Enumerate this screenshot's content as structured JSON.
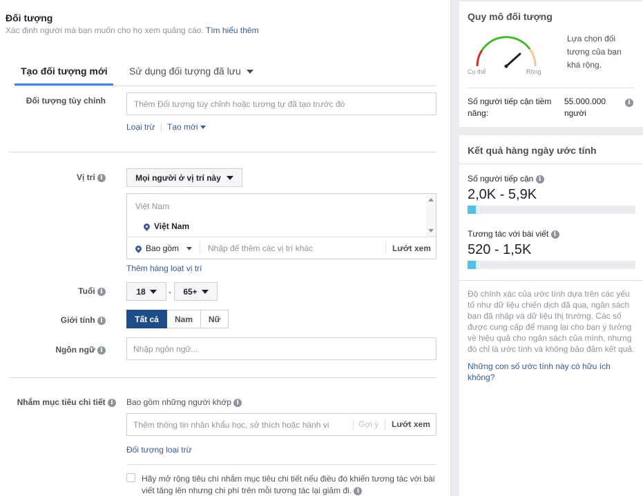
{
  "header": {
    "title": "Đối tượng",
    "subtitle": "Xác định người mà bạn muốn cho họ xem quảng cáo.",
    "learn_more": "Tìm hiểu thêm"
  },
  "tabs": [
    {
      "label": "Tạo đối tượng mới",
      "active": true
    },
    {
      "label": "Sử dụng đối tượng đã lưu",
      "active": false
    }
  ],
  "custom_audience": {
    "label": "Đối tượng tùy chỉnh",
    "placeholder": "Thêm Đối tượng tùy chỉnh hoặc tương tự đã tạo trước đó",
    "exclude": "Loại trừ",
    "create_new": "Tạo mới"
  },
  "location": {
    "label": "Vị trí",
    "dropdown": "Mọi người ở vị trí này",
    "list_header": "Việt Nam",
    "selected": "Việt Nam",
    "include": "Bao gồm",
    "placeholder": "Nhập để thêm các vị trí khác",
    "browse": "Lướt xem",
    "bulk_add": "Thêm hàng loạt vị trí"
  },
  "age": {
    "label": "Tuổi",
    "min": "18",
    "separator": "-",
    "max": "65+"
  },
  "gender": {
    "label": "Giới tính",
    "options": [
      {
        "label": "Tất cả",
        "selected": true
      },
      {
        "label": "Nam",
        "selected": false
      },
      {
        "label": "Nữ",
        "selected": false
      }
    ]
  },
  "language": {
    "label": "Ngôn ngữ",
    "placeholder": "Nhập ngôn ngữ..."
  },
  "detailed": {
    "label": "Nhắm mục tiêu chi tiết",
    "include_label": "Bao gồm những người khớp",
    "placeholder": "Thêm thông tin nhân khẩu học, sở thích hoặc hành vi",
    "suggest": "Gợi ý",
    "browse": "Lướt xem",
    "exclude": "Đối tượng loại trừ",
    "expand_line1": "Hãy mở rộng tiêu chí nhắm mục tiêu chi tiết nếu điều đó khiến tương tác với bài",
    "expand_line2": "viết tăng lên nhưng chi phí trên mỗi tương tác lại giảm đi."
  },
  "audience_size": {
    "title": "Quy mô đối tượng",
    "specific": "Cụ thể",
    "broad": "Rộng",
    "description": [
      "Lựa chọn đối",
      "tượng của bạn",
      "khá rộng."
    ],
    "reach_label": [
      "Số người tiếp cận tiềm",
      "năng:"
    ],
    "reach_value": [
      "55.000.000",
      "người"
    ],
    "colors": {
      "specific": "#d0312d",
      "ok": "#42b72a",
      "broad": "#f7c58f"
    }
  },
  "daily_results": {
    "title": "Kết quả hàng ngày ước tính",
    "reach_label": "Số người tiếp cận",
    "reach_value": "2,0K - 5,9K",
    "reach_fill": 0.02,
    "engagement_label": "Tương tác với bài viết",
    "engagement_value": "520 - 1,5K",
    "engagement_fill": 0.02,
    "disclaimer": [
      "Độ chính xác của ước tính dựa trên các yếu",
      "tố như dữ liệu chiến dịch đã qua, ngân sách",
      "bạn đã nhập và dữ liệu thị trường. Các số",
      "được cung cấp để mang lại cho bạn ý tưởng",
      "về hiệu quả cho ngân sách của mình, nhưng",
      "đó chỉ là ước tính và không bảo đảm kết quả."
    ],
    "feedback": [
      "Những con số ước tính này có hữu ích",
      "không?"
    ]
  }
}
